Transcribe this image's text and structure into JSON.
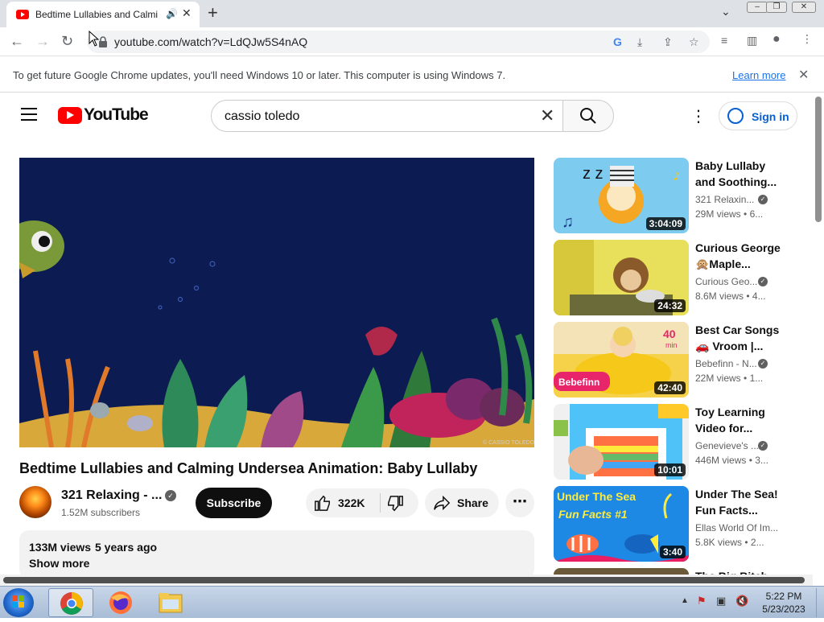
{
  "browser": {
    "tab_title": "Bedtime Lullabies and Calmi",
    "url": "youtube.com/watch?v=LdQJw5S4nAQ",
    "new_tab_symbol": "+",
    "infobar_message": "To get future Google Chrome updates, you'll need Windows 10 or later. This computer is using Windows 7.",
    "infobar_link": "Learn more"
  },
  "youtube": {
    "logo_text": "YouTube",
    "search_query": "cassio toledo",
    "sign_in": "Sign in"
  },
  "video": {
    "title": "Bedtime Lullabies and Calming Undersea Animation: Baby Lullaby",
    "channel": "321 Relaxing - ...",
    "subscribers": "1.52M subscribers",
    "subscribe_label": "Subscribe",
    "likes": "322K",
    "share_label": "Share",
    "views": "133M views",
    "age": "5 years ago",
    "show_more": "Show more",
    "watermark": "© CASSIO TOLEDO"
  },
  "recommendations": [
    {
      "title": "Baby Lullaby and Soothing...",
      "channel": "321 Relaxin...",
      "views": "29M views",
      "age": "• 6...",
      "duration": "3:04:09",
      "verified": true,
      "thumb_colors": [
        "#7ecbf0",
        "#f5a623"
      ]
    },
    {
      "title": "Curious George 🙊Maple...",
      "channel": "Curious Geo...",
      "views": "8.6M views",
      "age": "• 4...",
      "duration": "24:32",
      "verified": true,
      "thumb_colors": [
        "#e8e05a",
        "#8b5a2b"
      ]
    },
    {
      "title": "Best Car Songs 🚗 Vroom |...",
      "channel": "Bebefinn - N...",
      "views": "22M views",
      "age": "• 1...",
      "duration": "42:40",
      "verified": true,
      "badge": "40 min",
      "thumb_colors": [
        "#f6d24a",
        "#e84c8b"
      ]
    },
    {
      "title": "Toy Learning Video for...",
      "channel": "Genevieve's ...",
      "views": "446M views",
      "age": "• 3...",
      "duration": "10:01",
      "verified": true,
      "thumb_colors": [
        "#4fc3f7",
        "#ff7043"
      ]
    },
    {
      "title": "Under The Sea! Fun Facts...",
      "channel": "Ellas World Of Im...",
      "views": "5.8K views",
      "age": "• 2...",
      "duration": "3:40",
      "verified": false,
      "thumb_colors": [
        "#1e88e5",
        "#ffeb3b"
      ],
      "thumb_text": "Under The Sea Fun Facts"
    },
    {
      "title": "The Big Bitch...",
      "partial": true
    }
  ],
  "taskbar": {
    "time": "5:22 PM",
    "date": "5/23/2023"
  },
  "colors": {
    "youtube_red": "#ff0000",
    "link_blue": "#065fd4",
    "player_bg": "#0c1b52"
  }
}
